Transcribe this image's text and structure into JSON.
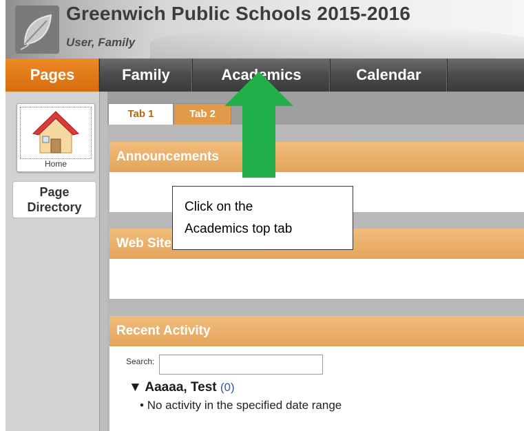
{
  "header": {
    "school_title": "Greenwich Public Schools 2015-2016",
    "user_name": "User, Family"
  },
  "nav": {
    "items": [
      {
        "label": "Pages",
        "active": true
      },
      {
        "label": "Family"
      },
      {
        "label": "Academics"
      },
      {
        "label": "Calendar"
      }
    ],
    "active_color": "#e07d1c"
  },
  "sidebar": {
    "home_label": "Home",
    "page_directory_line1": "Page",
    "page_directory_line2": "Directory"
  },
  "tabs": [
    {
      "label": "Tab 1",
      "active": true
    },
    {
      "label": "Tab 2"
    }
  ],
  "panels": {
    "announcements_title": "Announcements",
    "web_sites_title": "Web Sites",
    "recent_activity_title": "Recent Activity"
  },
  "recent_activity": {
    "search_label": "Search:",
    "search_value": "",
    "person_name": "Aaaaa, Test",
    "person_count": "(0)",
    "expand_glyph": "▼",
    "no_activity_text": "No activity in the specified date range"
  },
  "callout": {
    "line1": "Click on the",
    "line2": "Academics top tab",
    "arrow_color": "#22b04b"
  },
  "colors": {
    "panel_header": "#e4a45a",
    "accent_orange": "#e07d1c"
  }
}
